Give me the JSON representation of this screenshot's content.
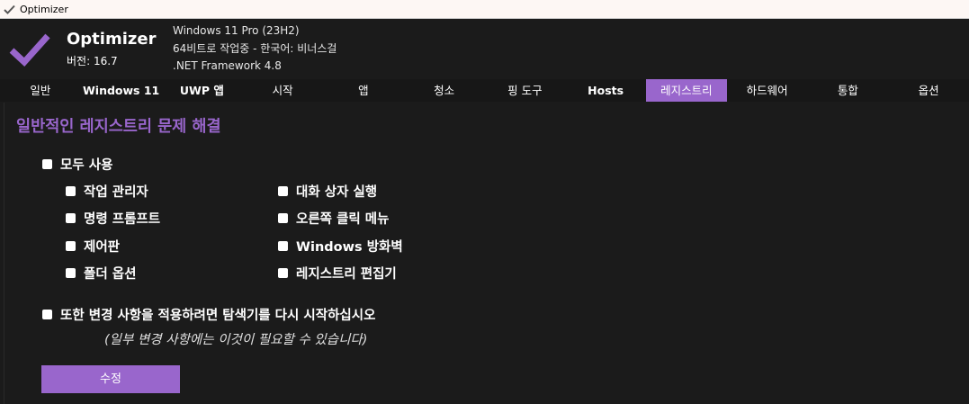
{
  "window": {
    "title": "Optimizer",
    "icon": "check-icon"
  },
  "header": {
    "app_name": "Optimizer",
    "version": "버전: 16.7",
    "sysinfo": [
      "Windows 11 Pro (23H2)",
      "64비트로 작업중 - 한국어: 비너스걸",
      ".NET Framework 4.8"
    ],
    "logo": "checkmark-logo",
    "logo_color": "#9966cc"
  },
  "tabs": [
    {
      "label": "일반"
    },
    {
      "label": "Windows 11"
    },
    {
      "label": "UWP 앱"
    },
    {
      "label": "시작"
    },
    {
      "label": "앱"
    },
    {
      "label": "청소"
    },
    {
      "label": "핑 도구"
    },
    {
      "label": "Hosts"
    },
    {
      "label": "레지스트리",
      "active": true
    },
    {
      "label": "하드웨어"
    },
    {
      "label": "통합"
    },
    {
      "label": "옵션"
    }
  ],
  "registry": {
    "title": "일반적인 레지스트리 문제 해결",
    "enable_all": "모두 사용",
    "options_left": [
      "작업 관리자",
      "명령 프롬프트",
      "제어판",
      "폴더 옵션"
    ],
    "options_right": [
      "대화 상자 실행",
      "오른쪽 클릭 메뉴",
      "Windows 방화벽",
      "레지스트리 편집기"
    ],
    "restart_explorer": "또한 변경 사항을 적용하려면 탐색기를 다시 시작하십시오",
    "restart_note": "(일부 변경 사항에는 이것이 필요할 수 있습니다)",
    "apply_button": "수정"
  },
  "colors": {
    "accent": "#9966cc",
    "background": "#1b1b1b",
    "tab_bar": "#171717"
  }
}
